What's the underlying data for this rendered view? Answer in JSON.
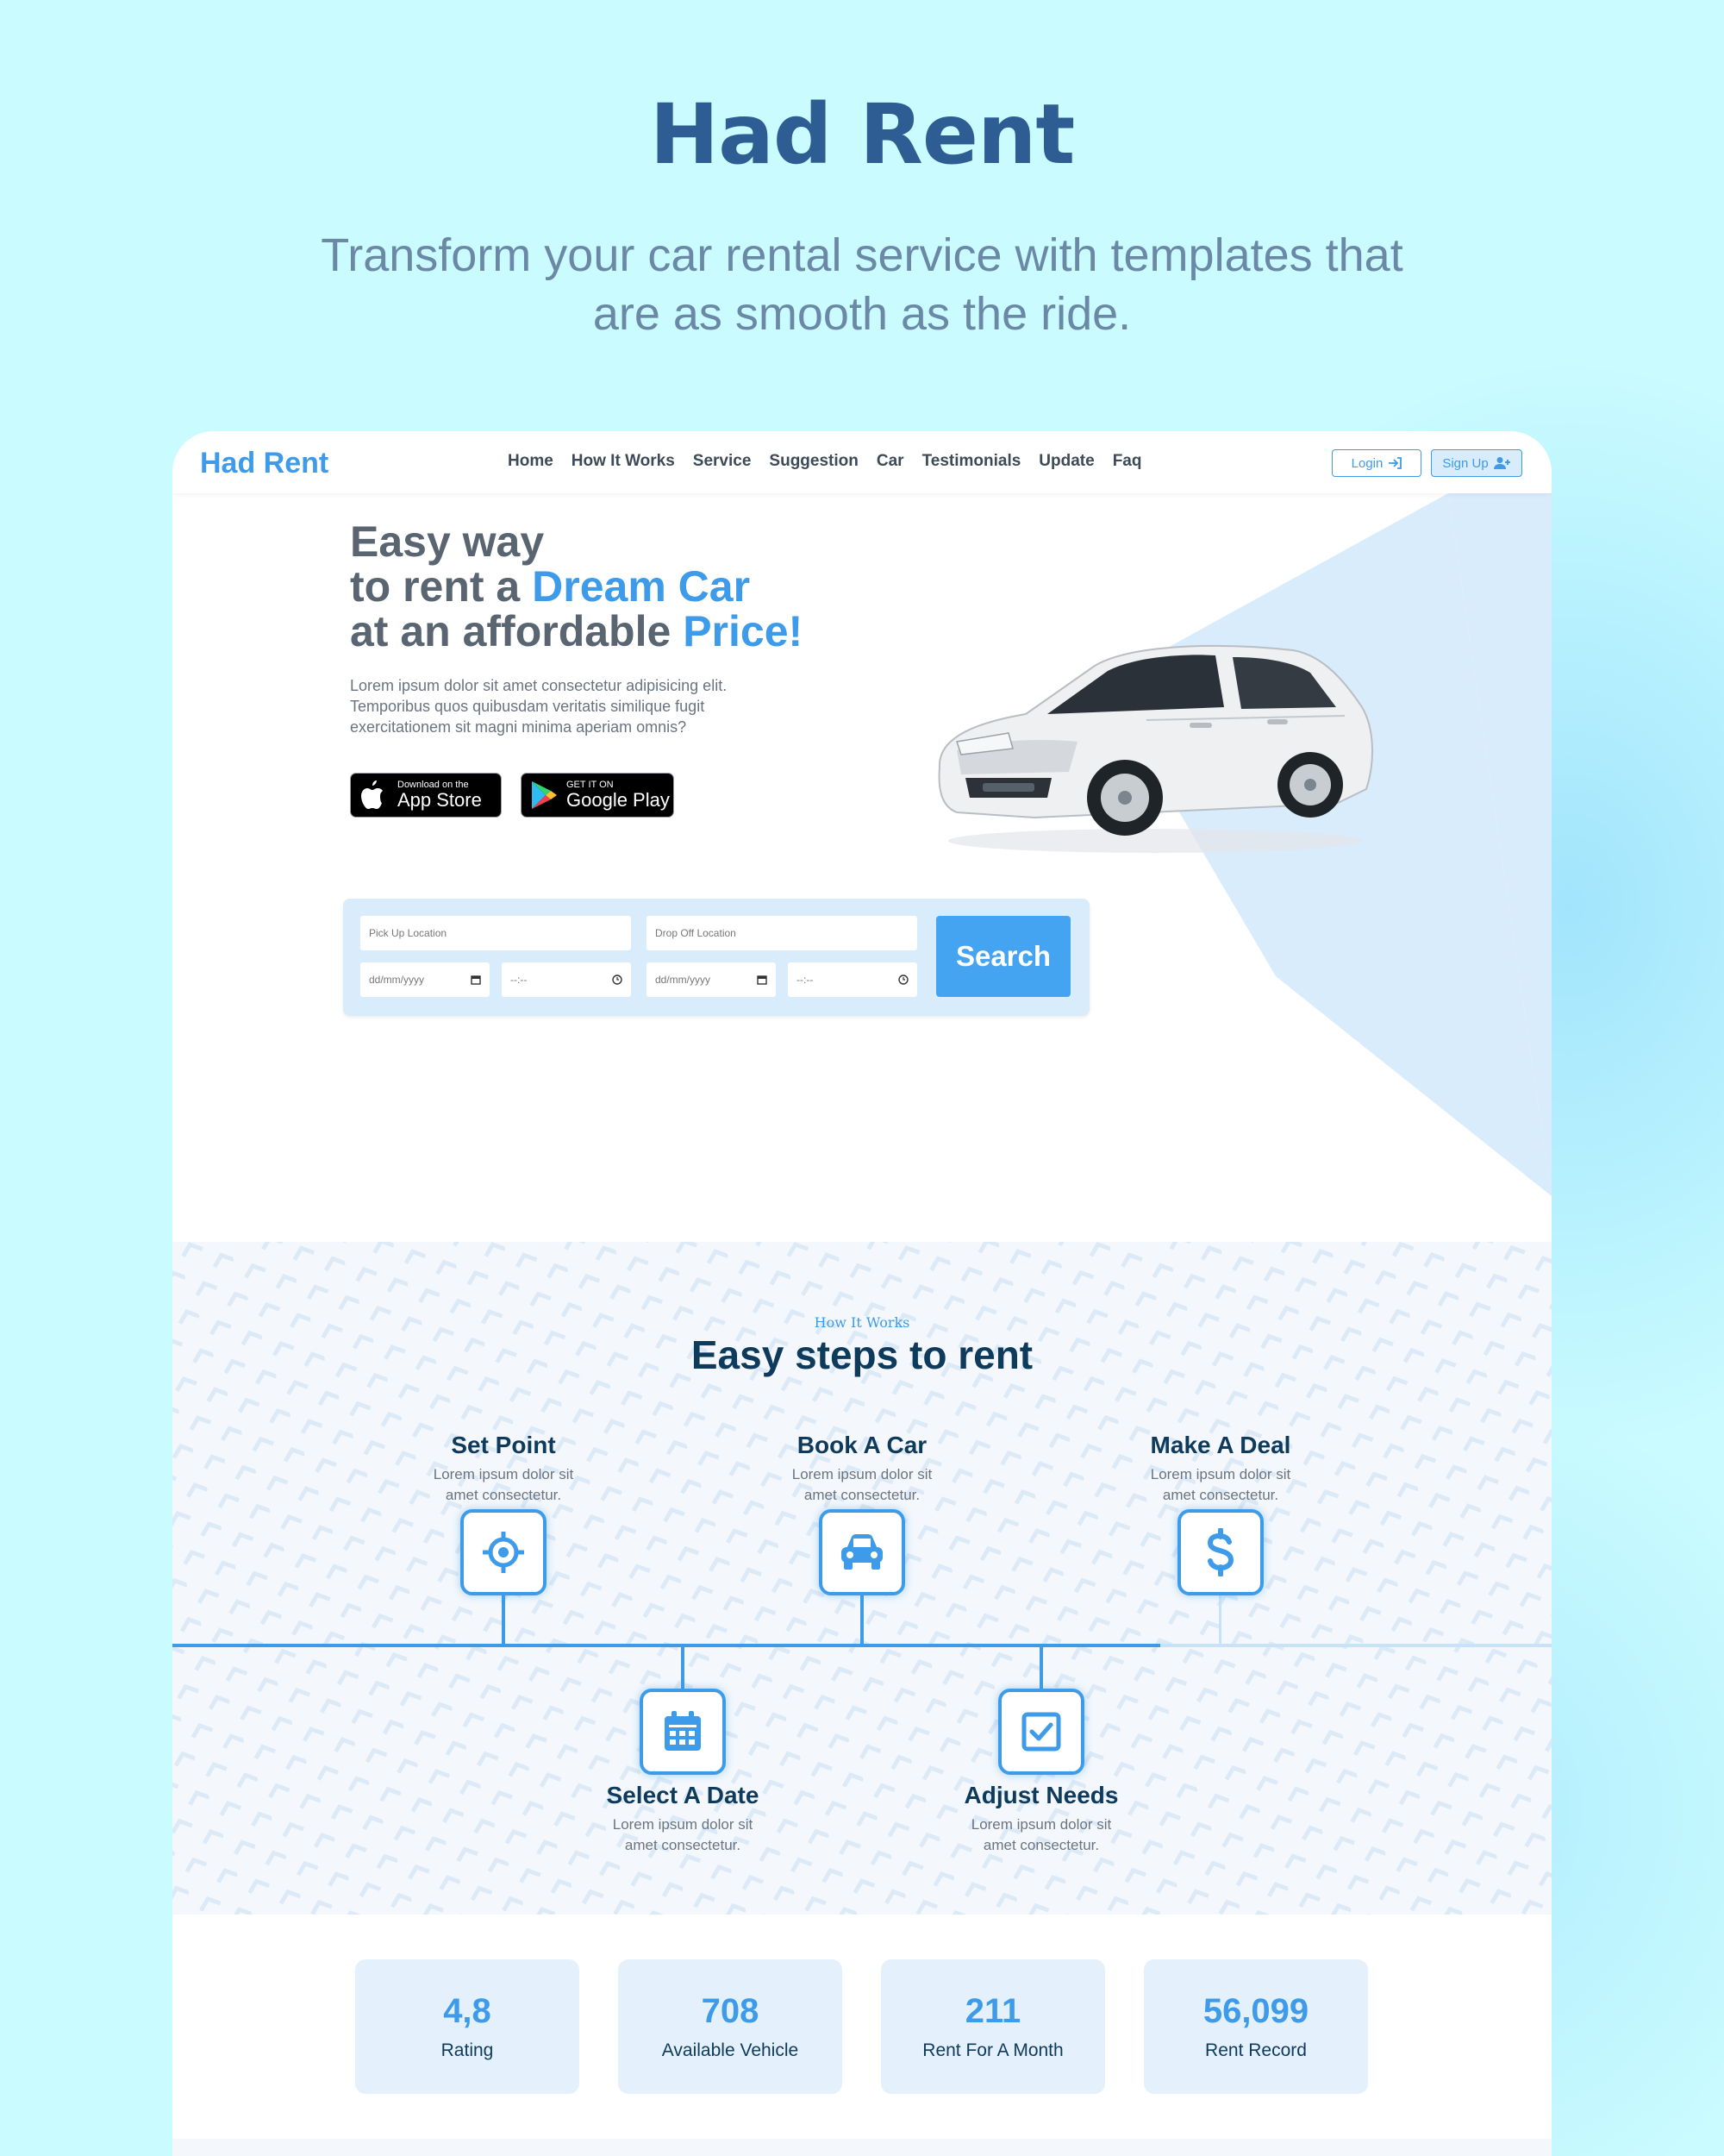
{
  "promo": {
    "title": "Had Rent",
    "subtitle_line1": "Transform your car rental service with templates that",
    "subtitle_line2": "are as smooth as the ride."
  },
  "nav": {
    "brand": "Had Rent",
    "links": [
      "Home",
      "How It Works",
      "Service",
      "Suggestion",
      "Car",
      "Testimonials",
      "Update",
      "Faq"
    ],
    "login_label": "Login",
    "signup_label": "Sign Up"
  },
  "hero": {
    "line1": "Easy way",
    "line2_prefix": "to rent a ",
    "line2_accent": "Dream Car",
    "line3_prefix": "at an affordable ",
    "line3_accent": "Price!",
    "description": "Lorem ipsum dolor sit amet consectetur adipisicing elit. Temporibus quos quibusdam veritatis similique fugit exercitationem sit magni minima aperiam omnis?",
    "app_store_small": "Download on the",
    "app_store_big": "App Store",
    "google_play_small": "GET IT ON",
    "google_play_big": "Google Play"
  },
  "search": {
    "pickup_placeholder": "Pick Up Location",
    "dropoff_placeholder": "Drop Off Location",
    "date_placeholder": "dd/mm/yyyy",
    "time_placeholder": "--:--",
    "button_label": "Search"
  },
  "how_it_works": {
    "eyebrow": "How It Works",
    "heading": "Easy steps to rent",
    "steps": [
      {
        "title": "Set Point",
        "desc1": "Lorem ipsum dolor sit",
        "desc2": "amet consectetur.",
        "icon": "crosshair-icon"
      },
      {
        "title": "Select A Date",
        "desc1": "Lorem ipsum dolor sit",
        "desc2": "amet consectetur.",
        "icon": "calendar-icon"
      },
      {
        "title": "Book A Car",
        "desc1": "Lorem ipsum dolor sit",
        "desc2": "amet consectetur.",
        "icon": "car-icon"
      },
      {
        "title": "Adjust Needs",
        "desc1": "Lorem ipsum dolor sit",
        "desc2": "amet consectetur.",
        "icon": "checkbox-icon"
      },
      {
        "title": "Make A Deal",
        "desc1": "Lorem ipsum dolor sit",
        "desc2": "amet consectetur.",
        "icon": "dollar-icon"
      }
    ]
  },
  "stats": [
    {
      "value": "4,8",
      "label": "Rating"
    },
    {
      "value": "708",
      "label": "Available Vehicle"
    },
    {
      "value": "211",
      "label": "Rent For A Month"
    },
    {
      "value": "56,099",
      "label": "Rent Record"
    }
  ],
  "colors": {
    "accent": "#3d9be9",
    "dark": "#0e3a5c",
    "page_bg": "#c9fbff"
  }
}
